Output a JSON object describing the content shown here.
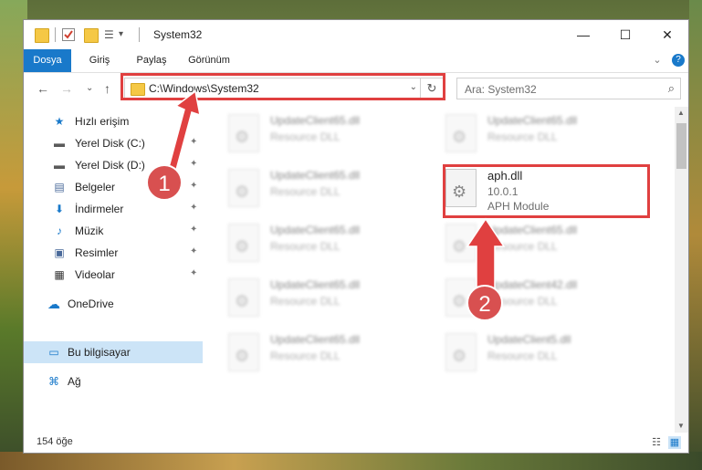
{
  "window": {
    "title": "System32",
    "minimize": "—",
    "maximize": "☐",
    "close": "✕"
  },
  "ribbon": {
    "tabs": [
      "Dosya",
      "Giriş",
      "Paylaş",
      "Görünüm"
    ],
    "expand": "⌄",
    "help": "?"
  },
  "address": {
    "path": "C:\\Windows\\System32",
    "dropdown": "⌄",
    "refresh": "↻"
  },
  "search": {
    "placeholder": "Ara: System32",
    "icon": "⌕"
  },
  "nav": {
    "back": "←",
    "forward": "→",
    "recent": "⌄",
    "up": "↑"
  },
  "sidebar": {
    "items": [
      {
        "label": "Hızlı erişim",
        "icon": "star-icon",
        "glyph": "★",
        "color": "#1979ca"
      },
      {
        "label": "Yerel Disk (C:)",
        "icon": "drive-icon",
        "glyph": "▬",
        "color": "#5a5a5a",
        "pinned": true
      },
      {
        "label": "Yerel Disk (D:)",
        "icon": "drive-icon",
        "glyph": "▬",
        "color": "#5a5a5a",
        "pinned": true
      },
      {
        "label": "Belgeler",
        "icon": "document-icon",
        "glyph": "▤",
        "color": "#4a6a9a",
        "pinned": true
      },
      {
        "label": "İndirmeler",
        "icon": "download-icon",
        "glyph": "⬇",
        "color": "#1979ca",
        "pinned": true
      },
      {
        "label": "Müzik",
        "icon": "music-icon",
        "glyph": "♪",
        "color": "#1979ca",
        "pinned": true
      },
      {
        "label": "Resimler",
        "icon": "pictures-icon",
        "glyph": "▣",
        "color": "#4a6a9a",
        "pinned": true
      },
      {
        "label": "Videolar",
        "icon": "video-icon",
        "glyph": "▦",
        "color": "#333333",
        "pinned": true
      },
      {
        "label": "OneDrive",
        "icon": "cloud-icon",
        "glyph": "☁",
        "color": "#1979ca"
      },
      {
        "label": "Bu bilgisayar",
        "icon": "computer-icon",
        "glyph": "▭",
        "color": "#1979ca",
        "selected": true
      },
      {
        "label": "Ağ",
        "icon": "network-icon",
        "glyph": "⌘",
        "color": "#1979ca"
      }
    ],
    "pin_glyph": "📌"
  },
  "files": [
    {
      "name": "UpdateClient65.dll",
      "desc": "Resource DLL",
      "blurred": true
    },
    {
      "name": "UpdateClient65.dll",
      "desc": "Resource DLL",
      "blurred": true
    },
    {
      "name": "UpdateClient65.dll",
      "desc": "Resource DLL",
      "blurred": true
    },
    {
      "name": "aph.dll",
      "desc": "10.0.1",
      "desc2": "APH Module",
      "blurred": false
    },
    {
      "name": "UpdateClient65.dll",
      "desc": "Resource DLL",
      "blurred": true
    },
    {
      "name": "UpdateClient65.dll",
      "desc": "Resource DLL",
      "blurred": true
    },
    {
      "name": "UpdateClient65.dll",
      "desc": "Resource DLL",
      "blurred": true
    },
    {
      "name": "UpdateClient42.dll",
      "desc": "Resource DLL",
      "blurred": true
    },
    {
      "name": "UpdateClient65.dll",
      "desc": "Resource DLL",
      "blurred": true
    },
    {
      "name": "UpdateClient5.dll",
      "desc": "Resource DLL",
      "blurred": true
    }
  ],
  "status": {
    "count": "154 öğe"
  },
  "annotations": {
    "step1": "1",
    "step2": "2",
    "color": "#e04040"
  }
}
